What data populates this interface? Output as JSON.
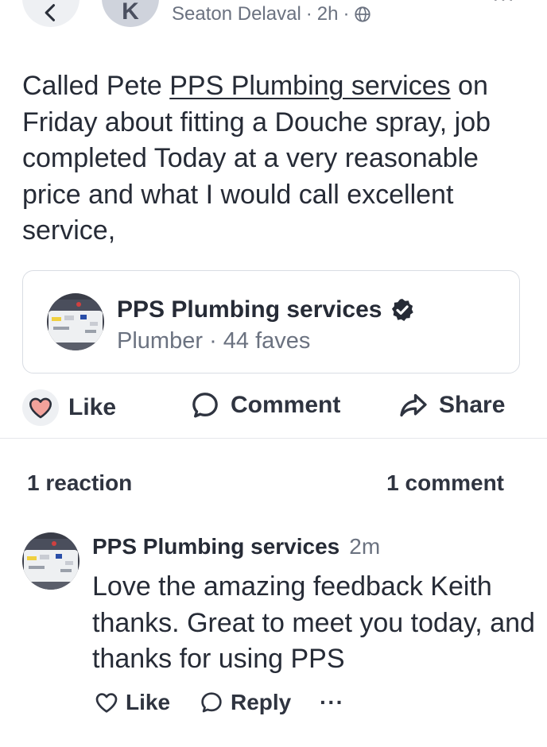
{
  "header": {
    "avatar_initial": "K",
    "location": "Seaton Delaval",
    "time": "2h",
    "separator": "·",
    "privacy_icon": "globe-icon",
    "more": "···"
  },
  "post": {
    "text_before": "Called Pete ",
    "link_text": "PPS Plumbing services",
    "text_after": " on Friday about fitting a Douche spray, job completed Today at a very reasonable price and what I would call excellent service,"
  },
  "business": {
    "name": "PPS Plumbing services",
    "verified_icon": "verified-badge-icon",
    "category": "Plumber",
    "separator": "·",
    "faves": "44 faves"
  },
  "actions": {
    "like": "Like",
    "comment": "Comment",
    "share": "Share"
  },
  "stats": {
    "reactions": "1 reaction",
    "comments": "1 comment"
  },
  "comment": {
    "author": "PPS Plumbing services",
    "time": "2m",
    "text": "Love the amazing feedback Keith thanks. Great to meet you today, and thanks for using PPS",
    "like": "Like",
    "reply": "Reply",
    "more": "···"
  },
  "colors": {
    "heart_fill": "#f2a29b",
    "muted": "#6b7280",
    "text": "#262b36"
  }
}
